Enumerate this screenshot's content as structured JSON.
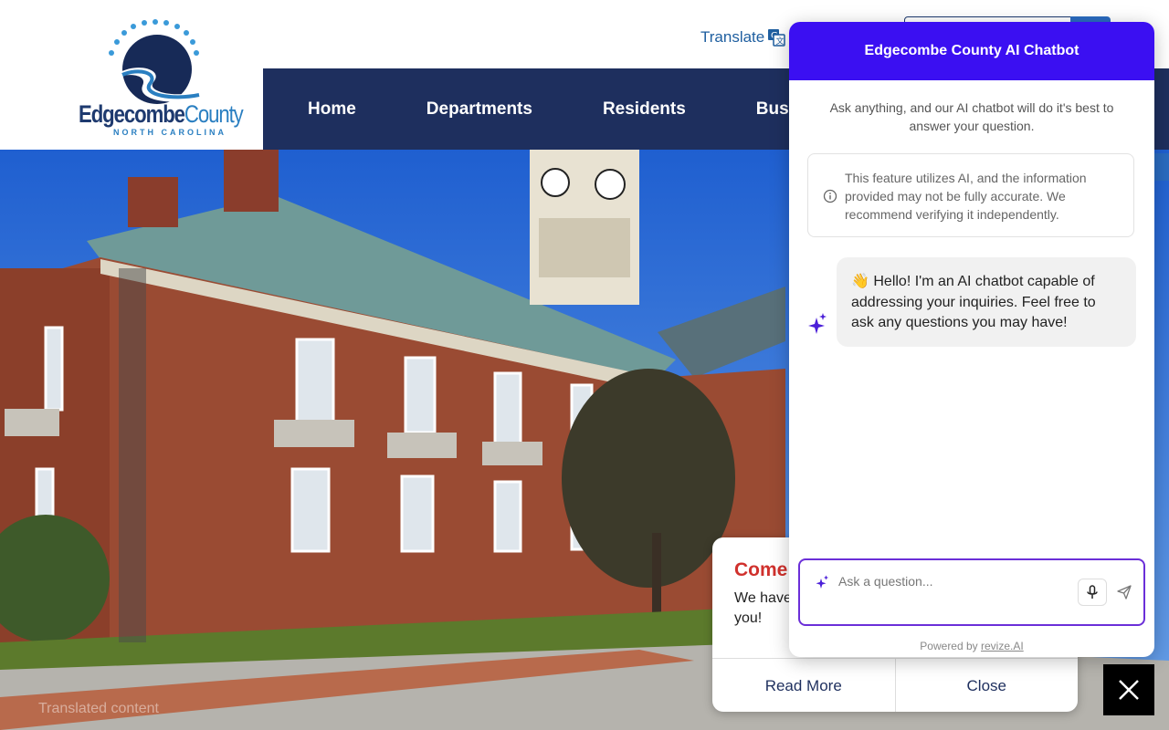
{
  "header": {
    "logo_main": "Edgecombe",
    "logo_county": "County",
    "logo_sub": "NORTH CAROLINA",
    "translate_label": "Translate"
  },
  "nav": {
    "items": [
      "Home",
      "Departments",
      "Residents",
      "Busi"
    ]
  },
  "alert": {
    "title": "Come",
    "body": "We have you!",
    "read_more": "Read More",
    "close": "Close"
  },
  "faded_text": "Translated content",
  "chatbot": {
    "title": "Edgecombe County AI Chatbot",
    "intro": "Ask anything, and our AI chatbot will do it's best to answer your question.",
    "notice": "This feature utilizes AI, and the information provided may not be fully accurate. We recommend verifying it independently.",
    "greeting": "👋 Hello! I'm an AI chatbot capable of addressing your inquiries. Feel free to ask any questions you may have!",
    "input_placeholder": "Ask a question...",
    "powered_prefix": "Powered by",
    "powered_link": "revize.AI"
  },
  "colors": {
    "nav_bg": "#1e2f5e",
    "chat_header": "#3b0ff2",
    "input_border": "#6b2fd8",
    "alert_title": "#d0312d"
  },
  "icons": {
    "translate": "translate-icon",
    "info": "info-icon",
    "sparkle": "sparkle-icon",
    "mic": "mic-icon",
    "send": "send-icon",
    "close": "close-icon"
  }
}
